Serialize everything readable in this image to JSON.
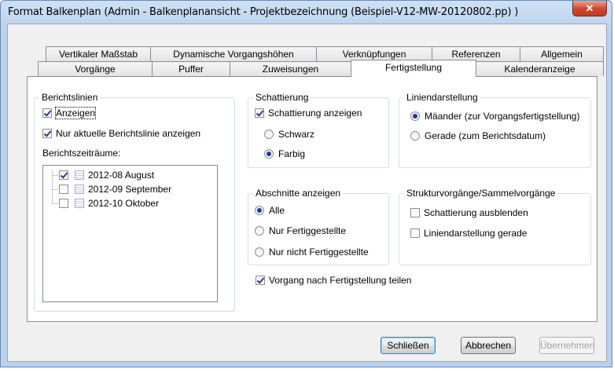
{
  "window": {
    "title": "Format Balkenplan (Admin - Balkenplanansicht - Projektbezeichnung (Beispiel-V12-MW-20120802.pp) )",
    "close_glyph": "✕"
  },
  "tabs_back": [
    "Vertikaler Maßstab",
    "Dynamische Vorgangshöhen",
    "Verknüpfungen",
    "Referenzen",
    "Allgemein"
  ],
  "tabs_front": [
    "Vorgänge",
    "Puffer",
    "Zuweisungen",
    "Fertigstellung",
    "Kalenderanzeige"
  ],
  "active_tab": "Fertigstellung",
  "berichtslinien": {
    "title": "Berichtslinien",
    "anzeigen": "Anzeigen",
    "nur_aktuelle": "Nur aktuelle Berichtslinie anzeigen",
    "zeitraeume_label": "Berichtszeiträume:",
    "items": [
      {
        "label": "2012-08 August",
        "checked": true
      },
      {
        "label": "2012-09 September",
        "checked": false
      },
      {
        "label": "2012-10 Oktober",
        "checked": false
      }
    ]
  },
  "schattierung": {
    "title": "Schattierung",
    "anzeigen": "Schattierung anzeigen",
    "schwarz": "Schwarz",
    "farbig": "Farbig"
  },
  "liniendarstellung": {
    "title": "Liniendarstellung",
    "maeander": "Mäander (zur Vorgangsfertigstellung)",
    "gerade": "Gerade (zum Berichtsdatum)"
  },
  "abschnitte": {
    "title": "Abschnitte anzeigen",
    "alle": "Alle",
    "nur_fertig": "Nur Fertiggestellte",
    "nur_nicht": "Nur nicht Fertiggestellte"
  },
  "struktur": {
    "title": "Strukturvorgänge/Sammelvorgänge",
    "schattierung_aus": "Schattierung ausblenden",
    "linie_gerade": "Liniendarstellung gerade"
  },
  "vorgang_teilen": "Vorgang nach Fertigstellung teilen",
  "buttons": {
    "schliessen": "Schließen",
    "abbrechen": "Abbrechen",
    "uebernehmen": "Übernehmen"
  }
}
